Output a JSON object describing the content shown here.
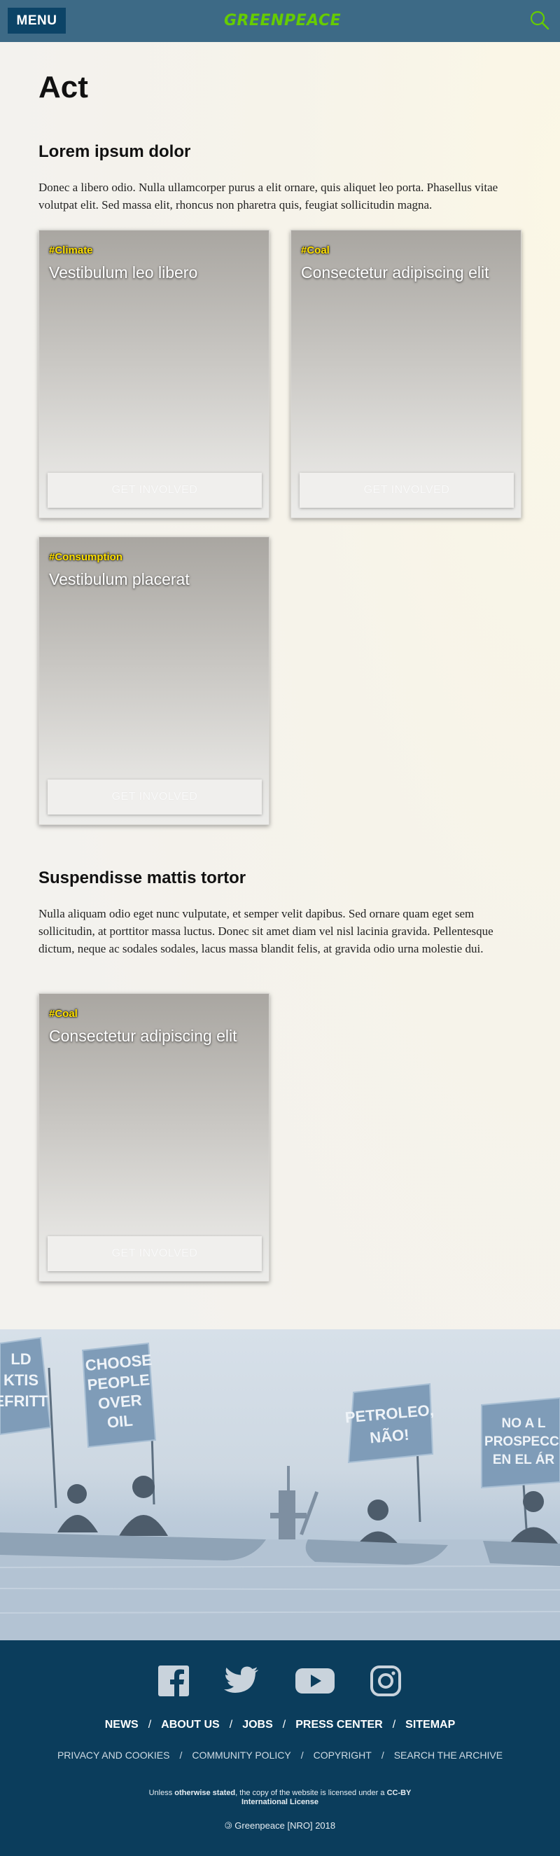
{
  "header": {
    "menu_label": "MENU",
    "logo_text": "GREENPEACE",
    "search_icon": "search-icon"
  },
  "main": {
    "title": "Act",
    "sections": [
      {
        "title": "Lorem ipsum dolor",
        "text": "Donec a libero odio. Nulla ullamcorper purus a elit ornare, quis aliquet leo porta. Phasellus vitae volutpat elit. Sed massa elit, rhoncus non pharetra quis, feugiat sollicitudin magna.",
        "cards": [
          {
            "tag": "#Climate",
            "title": "Vestibulum leo libero",
            "button": "GET INVOLVED"
          },
          {
            "tag": "#Coal",
            "title": "Consectetur adipiscing elit",
            "button": "GET INVOLVED"
          },
          {
            "tag": "#Consumption",
            "title": "Vestibulum placerat",
            "button": "GET INVOLVED"
          }
        ]
      },
      {
        "title": "Suspendisse mattis tortor",
        "text": "Nulla aliquam odio eget nunc vulputate, et semper velit dapibus. Sed ornare quam eget sem sollicitudin, at porttitor massa luctus. Donec sit amet diam vel nisl lacinia gravida. Pellentesque dictum, neque ac sodales sodales, lacus massa blandit felis, at gravida odio urna molestie dui.",
        "cards": [
          {
            "tag": "#Coal",
            "title": "Consectetur adipiscing elit",
            "button": "GET INVOLVED"
          }
        ]
      }
    ]
  },
  "hero": {
    "signs": [
      "LD KTIS EFRITT",
      "CHOOSE PEOPLE OVER OIL",
      "PETROLEO, NÃO!",
      "NO A L PROSPECCI EN EL ÁR"
    ]
  },
  "footer": {
    "social": [
      "facebook-icon",
      "twitter-icon",
      "youtube-icon",
      "instagram-icon"
    ],
    "nav": [
      "NEWS",
      "ABOUT US",
      "JOBS",
      "PRESS CENTER",
      "SITEMAP"
    ],
    "nav_sep": "/",
    "links": [
      "PRIVACY AND COOKIES",
      "COMMUNITY POLICY",
      "COPYRIGHT",
      "SEARCH THE ARCHIVE"
    ],
    "license_prefix": "Unless ",
    "license_bold1": "otherwise stated",
    "license_mid": ", the copy of the website is licensed under a ",
    "license_bold2": "CC-BY",
    "license_bold3": "International License",
    "copyright": "🄯 Greenpeace [NRO] 2018"
  },
  "colors": {
    "header_bg": "#3d6a86",
    "menu_bg": "#0c4467",
    "logo": "#66cc00",
    "tag": "#ffe000",
    "footer_bg": "#0b3d5c"
  }
}
